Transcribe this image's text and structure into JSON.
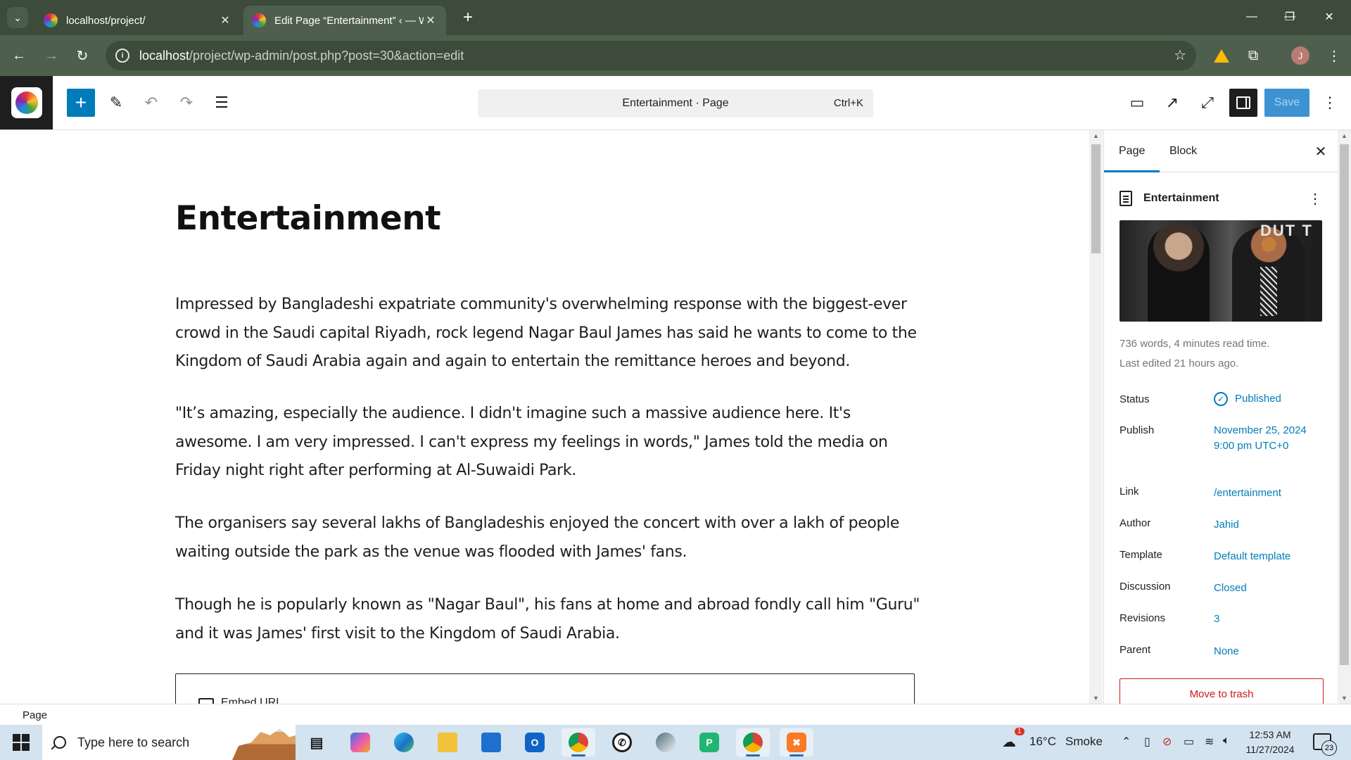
{
  "browser": {
    "tabs": [
      {
        "title": "localhost/project/",
        "close": "✕"
      },
      {
        "title": "Edit Page “Entertainment” ‹ — W",
        "close": "✕"
      }
    ],
    "new_tab": "+",
    "window_controls": {
      "minimize": "—",
      "restore": "❐",
      "close": "✕"
    },
    "url_host": "localhost",
    "url_path": "/project/wp-admin/post.php?post=30&action=edit",
    "profile_initial": "J"
  },
  "editor": {
    "doc_title": "Entertainment · Page",
    "doc_shortcut": "Ctrl+K",
    "save_label": "Save"
  },
  "content": {
    "title": "Entertainment",
    "paragraphs": [
      "Impressed by Bangladeshi expatriate community's overwhelming response with the biggest-ever crowd in the Saudi capital Riyadh, rock legend Nagar Baul James has said he wants to come to the Kingdom of Saudi Arabia again and again to entertain the remittance heroes and beyond.",
      "\"It’s amazing, especially the audience. I didn't imagine such a massive audience here. It's awesome. I am very impressed. I can't express my feelings in words,\" James told the media on Friday night right after performing at Al-Suwaidi Park.",
      "The organisers say several lakhs of Bangladeshis enjoyed the concert with over a lakh of people waiting outside the park as the venue was flooded with James' fans.",
      "Though he is popularly known as \"Nagar Baul\", his fans at home and abroad fondly call him \"Guru\" and it was James' first visit to the Kingdom of Saudi Arabia."
    ],
    "embed_label": "Embed URL"
  },
  "sidebar": {
    "tabs": [
      "Page",
      "Block"
    ],
    "page_name": "Entertainment",
    "image_word": "DUT T",
    "meta_words": "736 words, 4 minutes read time.",
    "meta_edited": "Last edited 21 hours ago.",
    "rows": [
      {
        "label": "Status",
        "value": "Published"
      },
      {
        "label": "Publish",
        "value": "November 25, 2024 9:00 pm UTC+0"
      },
      {
        "label": "Link",
        "value": "/entertainment"
      },
      {
        "label": "Author",
        "value": "Jahid"
      },
      {
        "label": "Template",
        "value": "Default template"
      },
      {
        "label": "Discussion",
        "value": "Closed"
      },
      {
        "label": "Revisions",
        "value": "3"
      },
      {
        "label": "Parent",
        "value": "None"
      }
    ],
    "trash_label": "Move to trash"
  },
  "footer": {
    "breadcrumb": "Page"
  },
  "taskbar": {
    "search_placeholder": "Type here to search",
    "weather_temp": "16°C",
    "weather_desc": "Smoke",
    "weather_alert": "1",
    "time": "12:53 AM",
    "date": "11/27/2024",
    "notification_count": "23"
  },
  "colors": {
    "accent": "#007cba",
    "danger": "#cc1818",
    "chrome": "#3c4b3a"
  }
}
